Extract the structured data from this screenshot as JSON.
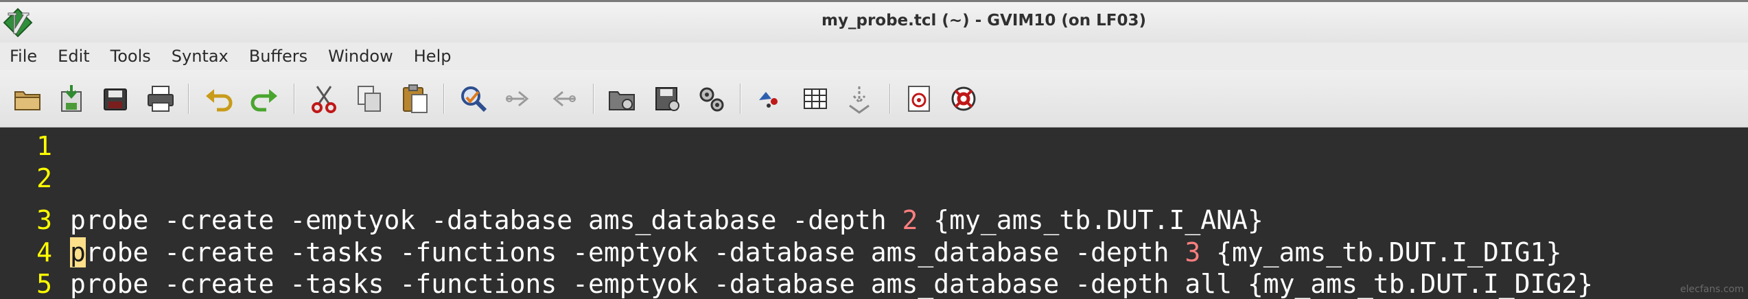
{
  "window": {
    "title": "my_probe.tcl (~) - GVIM10 (on  LF03)",
    "app_icon": "vim-icon"
  },
  "menu": {
    "items": [
      "File",
      "Edit",
      "Tools",
      "Syntax",
      "Buffers",
      "Window",
      "Help"
    ]
  },
  "toolbar": {
    "buttons": [
      {
        "name": "open-file-icon"
      },
      {
        "name": "save-file-icon"
      },
      {
        "name": "save-all-icon"
      },
      {
        "name": "print-icon"
      },
      {
        "name": "undo-icon"
      },
      {
        "name": "redo-icon"
      },
      {
        "name": "cut-icon"
      },
      {
        "name": "copy-icon"
      },
      {
        "name": "paste-icon"
      },
      {
        "name": "find-replace-icon"
      },
      {
        "name": "find-next-icon"
      },
      {
        "name": "find-previous-icon"
      },
      {
        "name": "load-session-icon"
      },
      {
        "name": "save-session-icon"
      },
      {
        "name": "run-script-icon"
      },
      {
        "name": "make-icon"
      },
      {
        "name": "run-ctags-icon"
      },
      {
        "name": "jump-to-tag-icon"
      },
      {
        "name": "help-icon"
      },
      {
        "name": "find-help-icon"
      }
    ]
  },
  "editor": {
    "colors": {
      "background": "#2e2e2e",
      "line_number": "#ffff00",
      "text": "#ffffff",
      "number": "#ff7f7f",
      "cursor": "#ffe08a"
    },
    "lines": [
      {
        "num": "1",
        "code": ""
      },
      {
        "num": "2",
        "code": ""
      },
      {
        "num": "3",
        "pre": "probe -create -emptyok -database ams_database -depth ",
        "value": "2",
        "post": " {my_ams_tb.DUT.I_ANA}"
      },
      {
        "num": "4",
        "cursor": "p",
        "pre": "robe -create -tasks -functions -emptyok -database ams_database -depth ",
        "value": "3",
        "post": " {my_ams_tb.DUT.I_DIG1}"
      },
      {
        "num": "5",
        "pre": "probe -create -tasks -functions -emptyok -database ams_database -depth all {my_ams_tb.DUT.I_DIG2}"
      }
    ]
  },
  "watermark": "elecfans.com"
}
